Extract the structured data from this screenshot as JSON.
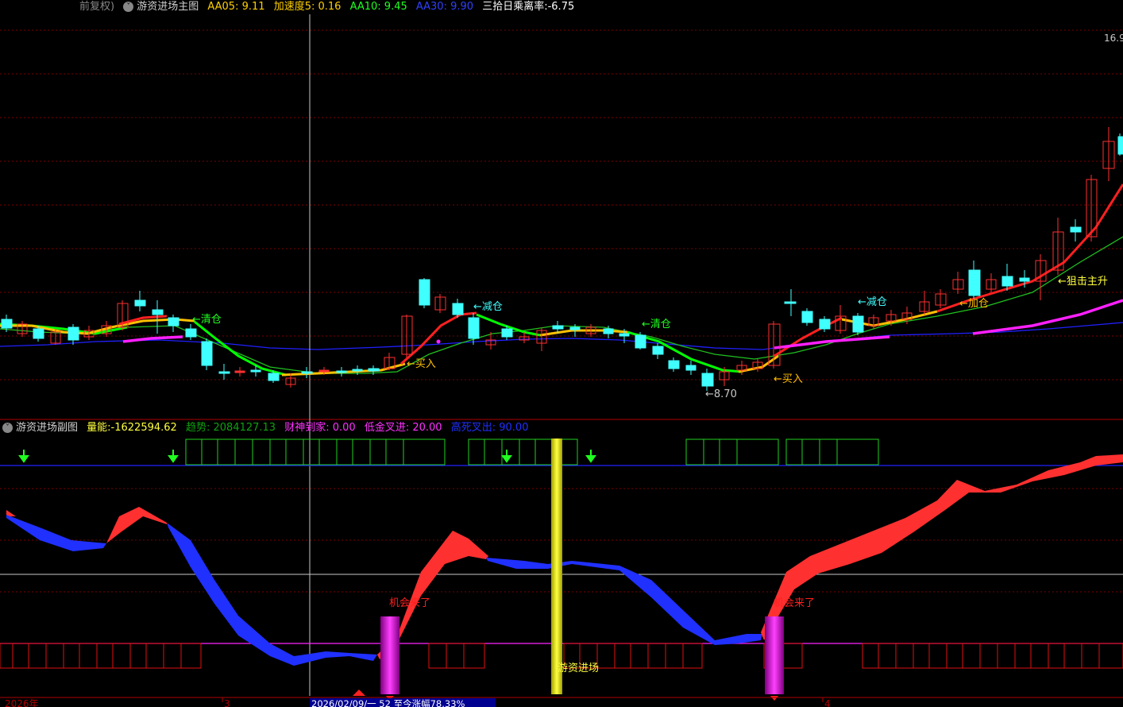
{
  "main_header": {
    "prefix": "前复权)",
    "title": "游资进场主图",
    "aa05_label": "AA05:",
    "aa05_value": "9.11",
    "accel_label": "加速度5:",
    "accel_value": "0.16",
    "aa10_label": "AA10:",
    "aa10_value": "9.45",
    "aa30_label": "AA30:",
    "aa30_value": "9.90",
    "bias_label": "三拾日乘离率:",
    "bias_value": "-6.75"
  },
  "price_label": "16.9",
  "main_annotations": {
    "clear1": "←清仓",
    "reduce1": "←减仓",
    "buy1": "←买入",
    "clear2": "←清仓",
    "low": "←8.70",
    "reduce2": "←减仓",
    "add": "←加仓",
    "buy2": "←买入",
    "snipe": "←狙击主升"
  },
  "sub_header": {
    "title": "游资进场副图",
    "vol_label": "量能:",
    "vol_value": "-1622594.62",
    "trend_label": "趋势:",
    "trend_value": "2084127.13",
    "wealth_label": "财神到家:",
    "wealth_value": "0.00",
    "goldcross_label": "低金叉进:",
    "goldcross_value": "20.00",
    "deathcross_label": "高死叉出:",
    "deathcross_value": "90.00"
  },
  "sub_annotations": {
    "chance1": "机会来了",
    "chance2": "机会来了",
    "hot_money": "游资进场"
  },
  "footer": {
    "year_label": "2026年",
    "tick_3": "3",
    "tick_4": "4",
    "cursor_info": "2026/02/09/一 52 至今涨幅78.33%"
  },
  "colors": {
    "aa05": "#ffd000",
    "accel": "#ffd000",
    "aa10": "#00ff00",
    "aa30": "#2020ff",
    "bias": "#ffffff",
    "vol": "#ffff00",
    "trend": "#00a000",
    "wealth": "#ff00ff",
    "goldcross": "#ff00ff",
    "deathcross": "#0000ff"
  }
}
